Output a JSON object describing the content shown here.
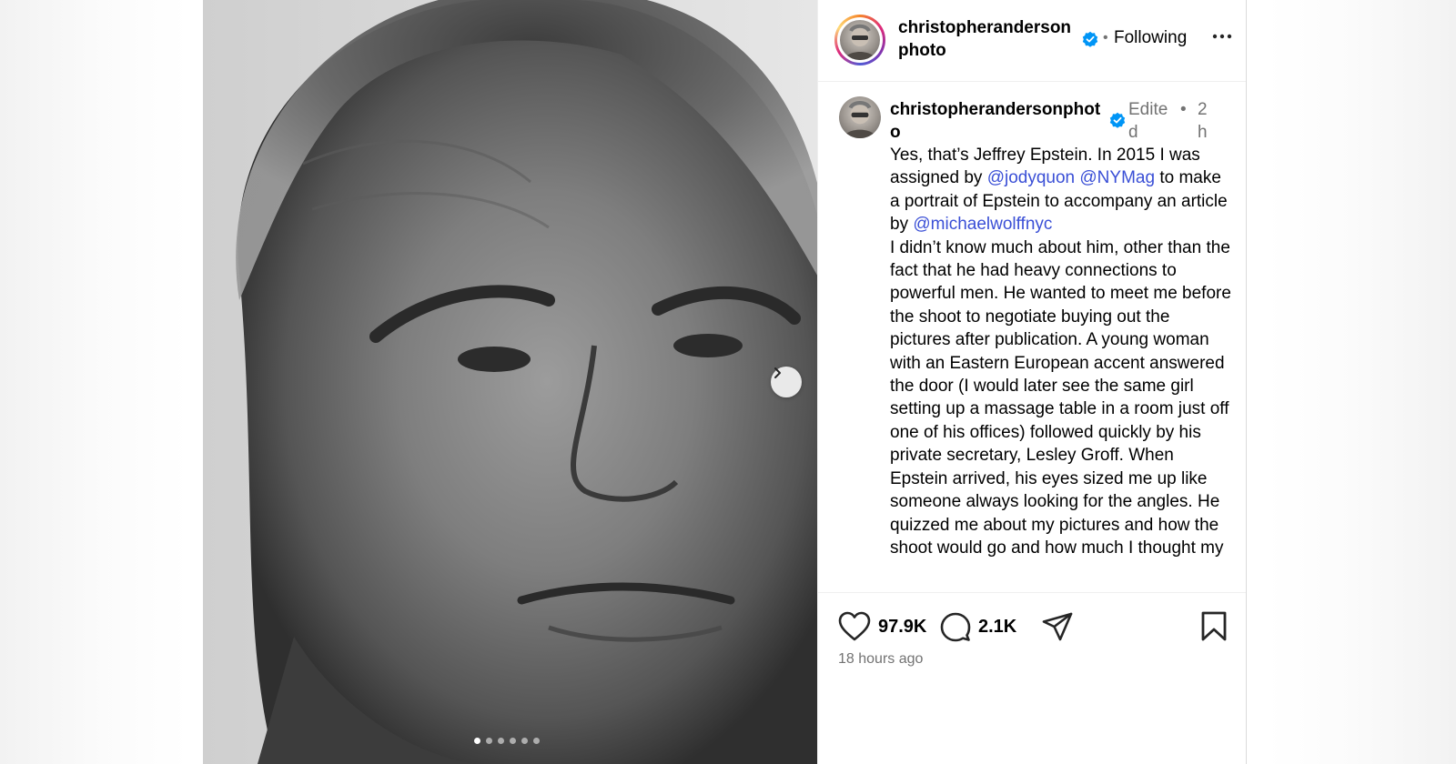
{
  "post": {
    "username": "christopherandersonphoto",
    "follow_status": "Following",
    "separator": "•",
    "carousel": {
      "total": 6,
      "active_index": 1
    }
  },
  "caption": {
    "username": "christopherandersonphoto",
    "edited_label": "Edited",
    "dot": "•",
    "time": "2h",
    "paragraph1": [
      {
        "text": "Yes, that’s Jeffrey Epstein. In 2015 I was assigned by "
      },
      {
        "text": "@jodyquon",
        "mention": true
      },
      {
        "text": " "
      },
      {
        "text": "@NYMag",
        "mention": true
      },
      {
        "text": " to make a portrait of Epstein to accompany an article by "
      },
      {
        "text": "@michaelwolffnyc",
        "mention": true
      }
    ],
    "paragraph2": "I didn’t know much about him, other than the fact that he had heavy connections to powerful men. He wanted to meet me before the shoot to negotiate buying out the pictures after publication. A young woman with an Eastern European accent answered the door (I would later see the same girl setting up a massage table in a room just off one of his offices) followed quickly by his private secretary, Lesley Groff. When Epstein arrived, his eyes sized me up like someone always looking for the angles. He quizzed me about my pictures and how the shoot would go and how much I thought my"
  },
  "actions": {
    "likes": "97.9K",
    "comments": "2.1K",
    "time_ago": "18 hours ago"
  },
  "icons": {
    "like": "heart-icon",
    "comment": "comment-bubble-icon",
    "share": "paper-plane-icon",
    "save": "bookmark-icon",
    "more": "more-dots-icon",
    "next": "chevron-right-icon",
    "verified": "verified-badge-icon"
  },
  "colors": {
    "verified": "#0095f6",
    "mention": "#3a4fd6",
    "muted": "#737373"
  }
}
